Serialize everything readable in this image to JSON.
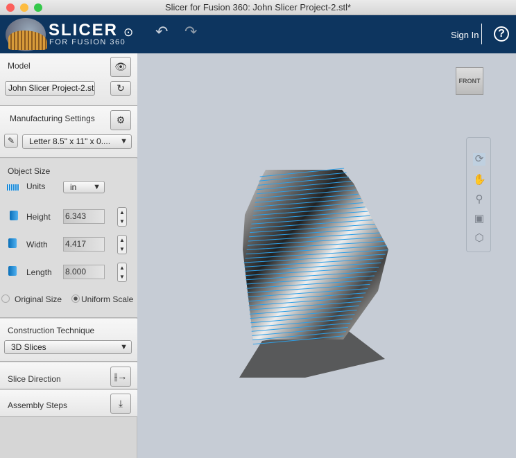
{
  "window": {
    "title": "Slicer for Fusion 360: John Slicer Project-2.stl*"
  },
  "header": {
    "brand": "SLICER",
    "brand_sub": "FOR FUSION 360",
    "sign_in": "Sign In",
    "help": "?"
  },
  "sidebar": {
    "model": {
      "label": "Model",
      "file": "John Slicer Project-2.stl"
    },
    "manufacturing": {
      "label": "Manufacturing Settings",
      "preset": "Letter 8.5\" x 11\" x 0...."
    },
    "object_size": {
      "label": "Object Size",
      "units_label": "Units",
      "units_value": "in",
      "height_label": "Height",
      "height": "6.343",
      "width_label": "Width",
      "width": "4.417",
      "length_label": "Length",
      "length": "8.000",
      "original_size": "Original Size",
      "uniform_scale": "Uniform Scale",
      "selected_scale": "Uniform Scale"
    },
    "construction": {
      "label": "Construction Technique",
      "value": "3D Slices"
    },
    "slice_direction": {
      "label": "Slice Direction"
    },
    "assembly_steps": {
      "label": "Assembly Steps"
    }
  },
  "viewport": {
    "view_cube": "FRONT",
    "nav_tools": [
      "orbit-icon",
      "pan-icon",
      "zoom-icon",
      "fit-icon",
      "home-view-icon"
    ],
    "slice_color": "#2e9fe6"
  }
}
